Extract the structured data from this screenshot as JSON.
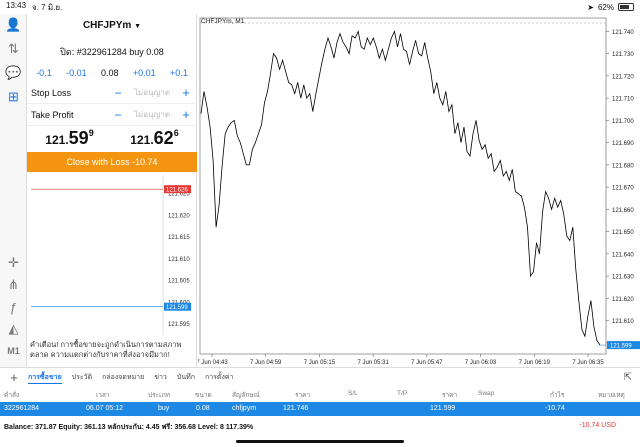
{
  "status_bar": {
    "time": "13:43",
    "date": "จ. 7 มิ.ย.",
    "battery": "62%",
    "battery_level": 0.62
  },
  "trade_panel": {
    "symbol": "CHFJPYm",
    "ticket_line": "ปิด: #322961284 buy 0.08",
    "volume_steps": [
      "-0.1",
      "-0.01",
      "0.08",
      "+0.01",
      "+0.1"
    ],
    "stop_loss": {
      "label": "Stop Loss",
      "value": "ไม่อนุญาต"
    },
    "take_profit": {
      "label": "Take Profit",
      "value": "ไม่อนุญาต"
    },
    "bid": {
      "base": "121.",
      "big": "59",
      "sup": "9"
    },
    "ask": {
      "base": "121.",
      "big": "62",
      "sup": "6"
    },
    "close_button": "Close with Loss -10.74",
    "warning": "คำเตือน! การซื้อขายจะถูกดำเนินการตามสภาพตลาด ความแตกต่างกับราคาที่ส่งอาจมีมาก!"
  },
  "mini_chart": {
    "ask_label": "121.626",
    "bid_label": "121.599",
    "ticks": [
      "121.625",
      "121.620",
      "121.615",
      "121.610",
      "121.605",
      "121.600",
      "121.595"
    ],
    "ask_color": "#e53935",
    "bid_color": "#1e88e5"
  },
  "main_chart": {
    "title": "CHFJPYm, M1",
    "y_ticks": [
      "121.740",
      "121.730",
      "121.720",
      "121.710",
      "121.700",
      "121.690",
      "121.680",
      "121.670",
      "121.660",
      "121.650",
      "121.640",
      "121.630",
      "121.620",
      "121.610",
      "121.600"
    ],
    "x_ticks": [
      "7 Jun 04:43",
      "7 Jun 04:59",
      "7 Jun 05:15",
      "7 Jun 05:31",
      "7 Jun 05:47",
      "7 Jun 06:03",
      "7 Jun 06:19",
      "7 Jun 06:35"
    ],
    "current_price_label": "121.599",
    "current_price_color": "#1e88e5"
  },
  "chart_data": {
    "type": "line",
    "title": "CHFJPYm, M1",
    "xlabel": "",
    "ylabel": "",
    "ylim": [
      121.595,
      121.746
    ],
    "x_tick_labels": [
      "7 Jun 04:43",
      "7 Jun 04:59",
      "7 Jun 05:15",
      "7 Jun 05:31",
      "7 Jun 05:47",
      "7 Jun 06:03",
      "7 Jun 06:19",
      "7 Jun 06:35"
    ],
    "series": [
      {
        "values": [
          121.703,
          121.713,
          121.706,
          121.697,
          121.682,
          121.652,
          121.662,
          121.68,
          121.694,
          121.697,
          121.699,
          121.7,
          121.693,
          121.69,
          121.685,
          121.68,
          121.68,
          121.687,
          121.69,
          121.694,
          121.698,
          121.708,
          121.713,
          121.721,
          121.73,
          121.728,
          121.723,
          121.727,
          121.722,
          121.717,
          121.716,
          121.712,
          121.717,
          121.71,
          121.716,
          121.71,
          121.712,
          121.704,
          121.712,
          121.719,
          121.726,
          121.732,
          121.737,
          121.733,
          121.728,
          121.735,
          121.739,
          121.735,
          121.733,
          121.73,
          121.738,
          121.737,
          121.74,
          121.733,
          121.732,
          121.737,
          121.734,
          121.737,
          121.733,
          121.728,
          121.732,
          121.727,
          121.732,
          121.737,
          121.74,
          121.733,
          121.739,
          121.732,
          121.731,
          121.725,
          121.731,
          121.736,
          121.73,
          121.729,
          121.735,
          121.728,
          121.722,
          121.712,
          121.717,
          121.71,
          121.707,
          121.713,
          121.704,
          121.707,
          121.694,
          121.699,
          121.69,
          121.697,
          121.686,
          121.684,
          121.694,
          121.7,
          121.691,
          121.687,
          121.689,
          121.683,
          121.685,
          121.677,
          121.679,
          121.682,
          121.675,
          121.677,
          121.673,
          121.678,
          121.668,
          121.667,
          121.666,
          121.661,
          121.652,
          121.63,
          121.632,
          121.645,
          121.64,
          121.659,
          121.668,
          121.665,
          121.66,
          121.665,
          121.661,
          121.664,
          121.658,
          121.648,
          121.646,
          121.652,
          121.633,
          121.619,
          121.606,
          121.603,
          121.612,
          121.619,
          121.607,
          121.601,
          121.599
        ],
        "color": "#000000"
      }
    ],
    "grid": false
  },
  "tabs": [
    "การซื้อขาย",
    "ประวัติ",
    "กล่องจดหมาย",
    "ข่าว",
    "บันทึก",
    "การตั้งค่า"
  ],
  "table": {
    "headers": [
      "คำสั่ง",
      "เวลา",
      "ประเภท",
      "ขนาด",
      "สัญลักษณ์",
      "ราคา",
      "S/L",
      "T/P",
      "ราคา",
      "Swap",
      "กำไร",
      "หมายเหตุ"
    ],
    "row": [
      "322961284",
      "06.07 05:12",
      "buy",
      "0.08",
      "chfjpym",
      "121.746",
      "",
      "",
      "121.599",
      "",
      "-10.74",
      ""
    ]
  },
  "footer": {
    "balance": "Balance: 371.87 Equity: 361.13 หลักประกัน: 4.45 ฟรี: 356.68 Level: 8 117.39%",
    "pl": "-10.74  USD"
  }
}
